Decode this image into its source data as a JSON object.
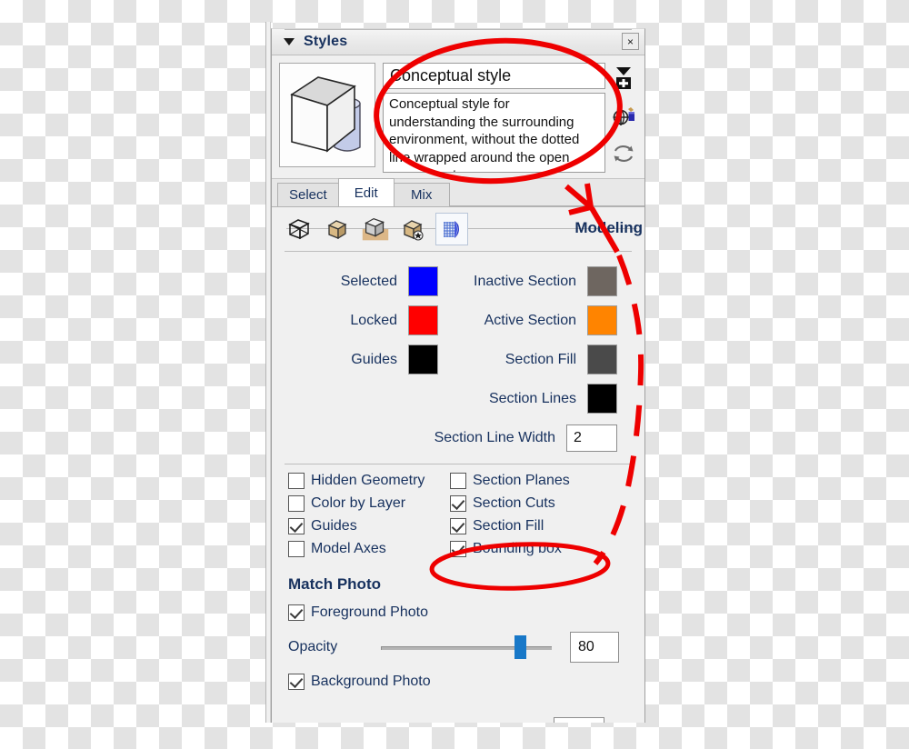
{
  "window": {
    "title": "Styles",
    "collapse_icon": "triangle-down-icon",
    "close_label": "×"
  },
  "style": {
    "name": "Conceptual style",
    "description": "Conceptual style for understanding the surrounding environment, without the dotted line wrapped around the open component",
    "thumbnail_name": "style-thumbnail-box-cylinder"
  },
  "side_buttons": [
    {
      "name": "create-new-style-button",
      "icon": "triangle-plus-icon"
    },
    {
      "name": "update-style-with-model-changes-button",
      "icon": "globe-paint-bucket-icon"
    },
    {
      "name": "refresh-style-button",
      "icon": "refresh-arrows-icon"
    }
  ],
  "tabs": [
    {
      "label": "Select",
      "active": false
    },
    {
      "label": "Edit",
      "active": true
    },
    {
      "label": "Mix",
      "active": false
    }
  ],
  "toolbar": {
    "section_label": "Modeling",
    "buttons": [
      {
        "name": "edge-settings-button",
        "icon": "wireframe-cube-icon",
        "selected": false
      },
      {
        "name": "face-settings-button",
        "icon": "shaded-cube-icon",
        "selected": false
      },
      {
        "name": "background-settings-button",
        "icon": "grey-cube-icon",
        "selected": true
      },
      {
        "name": "watermark-settings-button",
        "icon": "cube-star-icon",
        "selected": false
      },
      {
        "name": "modeling-settings-button",
        "icon": "grid-sphere-icon",
        "selected": true
      }
    ]
  },
  "colors": {
    "rows": [
      {
        "left": {
          "label": "Selected",
          "color": "#0000ff",
          "name": "selected-color-swatch"
        },
        "right": {
          "label": "Inactive Section",
          "color": "#6e6660",
          "name": "inactive-section-color-swatch"
        }
      },
      {
        "left": {
          "label": "Locked",
          "color": "#ff0000",
          "name": "locked-color-swatch"
        },
        "right": {
          "label": "Active Section",
          "color": "#ff8400",
          "name": "active-section-color-swatch"
        }
      },
      {
        "left": {
          "label": "Guides",
          "color": "#000000",
          "name": "guides-color-swatch"
        },
        "right": {
          "label": "Section Fill",
          "color": "#4a4a4a",
          "name": "section-fill-color-swatch"
        }
      },
      {
        "left": null,
        "right": {
          "label": "Section Lines",
          "color": "#000000",
          "name": "section-lines-color-swatch"
        }
      }
    ],
    "section_line_width": {
      "label": "Section Line Width",
      "value": "2"
    }
  },
  "checkboxes": [
    {
      "label": "Hidden Geometry",
      "checked": false,
      "name": "hidden-geometry-checkbox"
    },
    {
      "label": "Section Planes",
      "checked": false,
      "name": "section-planes-checkbox"
    },
    {
      "label": "Color by Layer",
      "checked": false,
      "name": "color-by-layer-checkbox"
    },
    {
      "label": "Section Cuts",
      "checked": true,
      "name": "section-cuts-checkbox"
    },
    {
      "label": "Guides",
      "checked": true,
      "name": "guides-checkbox"
    },
    {
      "label": "Section Fill",
      "checked": true,
      "name": "section-fill-checkbox"
    },
    {
      "label": "Model Axes",
      "checked": false,
      "name": "model-axes-checkbox"
    },
    {
      "label": "Bounding box",
      "checked": true,
      "name": "bounding-box-checkbox"
    }
  ],
  "match_photo": {
    "title": "Match Photo",
    "foreground": {
      "label": "Foreground Photo",
      "checked": true
    },
    "opacity": {
      "label": "Opacity",
      "value": "80",
      "percent": 78
    },
    "background": {
      "label": "Background Photo",
      "checked": true
    }
  },
  "annotations": {
    "accent_color": "#ee0000",
    "ellipse_top_target": "style name and description fields",
    "ellipse_bottom_target": "Bounding box checkbox",
    "arrow_name": "callout-arrow",
    "dashed_curve_name": "callout-dashed-curve"
  }
}
